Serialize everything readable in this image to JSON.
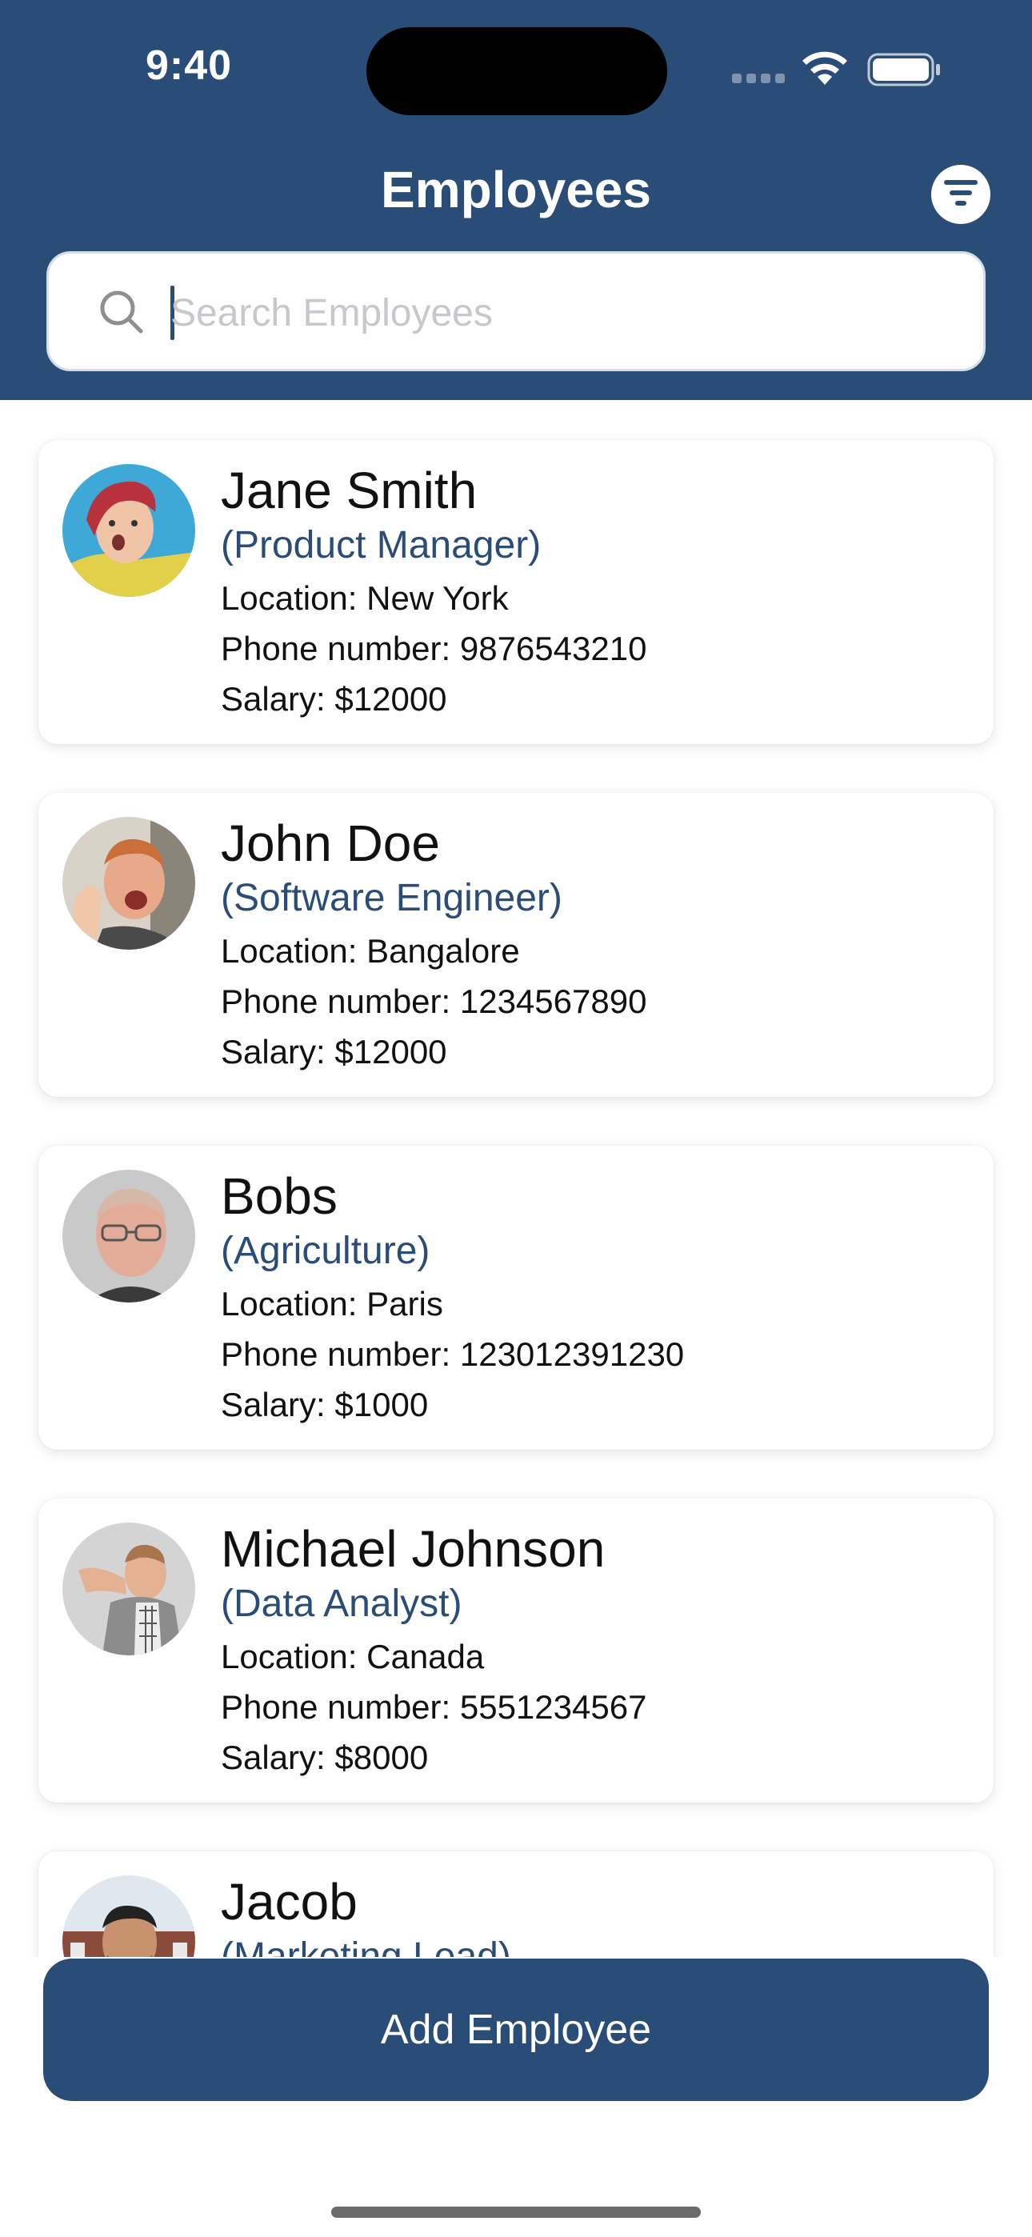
{
  "status_bar": {
    "time": "9:40"
  },
  "header": {
    "title": "Employees",
    "filter_icon": "filter-icon",
    "search_placeholder": "Search Employees",
    "search_value": ""
  },
  "colors": {
    "header_bg": "#2a4d78",
    "role_text": "#2a4d78",
    "button_bg": "#2a4d78",
    "button_text": "#ffffff"
  },
  "employees": [
    {
      "name": "Jane Smith",
      "role": "(Product Manager)",
      "location": "Location: New York",
      "phone": "Phone number: 9876543210",
      "salary": "Salary: $12000"
    },
    {
      "name": "John Doe",
      "role": "(Software Engineer)",
      "location": "Location: Bangalore",
      "phone": "Phone number: 1234567890",
      "salary": "Salary: $12000"
    },
    {
      "name": "Bobs",
      "role": "(Agriculture)",
      "location": "Location: Paris",
      "phone": "Phone number: 123012391230",
      "salary": "Salary: $1000"
    },
    {
      "name": "Michael Johnson",
      "role": "(Data Analyst)",
      "location": "Location: Canada",
      "phone": "Phone number: 5551234567",
      "salary": "Salary: $8000"
    },
    {
      "name": "Jacob",
      "role": "(Marketing Lead)",
      "location": "",
      "phone": "",
      "salary": ""
    }
  ],
  "actions": {
    "add_employee": "Add Employee"
  }
}
